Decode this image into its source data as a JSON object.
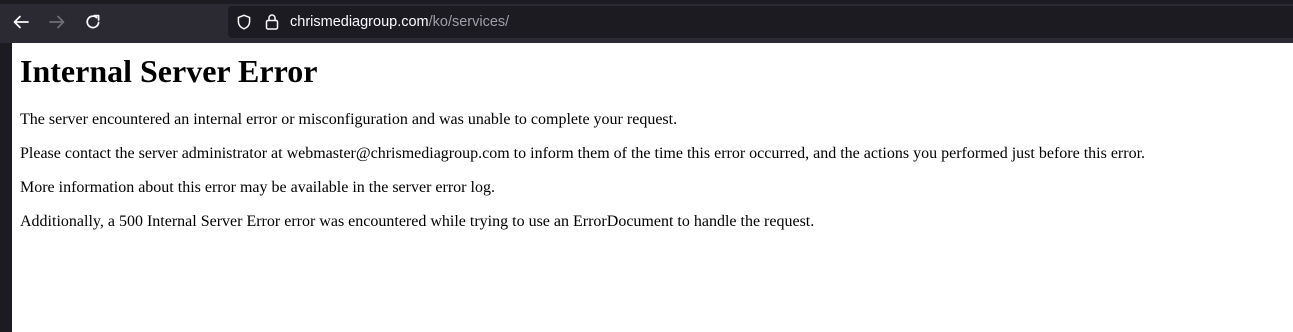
{
  "browser": {
    "url_host": "chrismediagroup.com",
    "url_path": "/ko/services/",
    "icons": {
      "back": "back-arrow-icon",
      "forward": "forward-arrow-icon",
      "reload": "reload-icon",
      "tracking_protection": "shield-icon",
      "security": "lock-icon"
    },
    "colors": {
      "toolbar": "#2b2a33",
      "urlbar": "#1c1b22",
      "url_host": "#fbfbfe",
      "url_path": "#9e9ea6"
    }
  },
  "page": {
    "title": "Internal Server Error",
    "paragraphs": [
      "The server encountered an internal error or misconfiguration and was unable to complete your request.",
      "Please contact the server administrator at webmaster@chrismediagroup.com to inform them of the time this error occurred, and the actions you performed just before this error.",
      "More information about this error may be available in the server error log.",
      "Additionally, a 500 Internal Server Error error was encountered while trying to use an ErrorDocument to handle the request."
    ]
  }
}
